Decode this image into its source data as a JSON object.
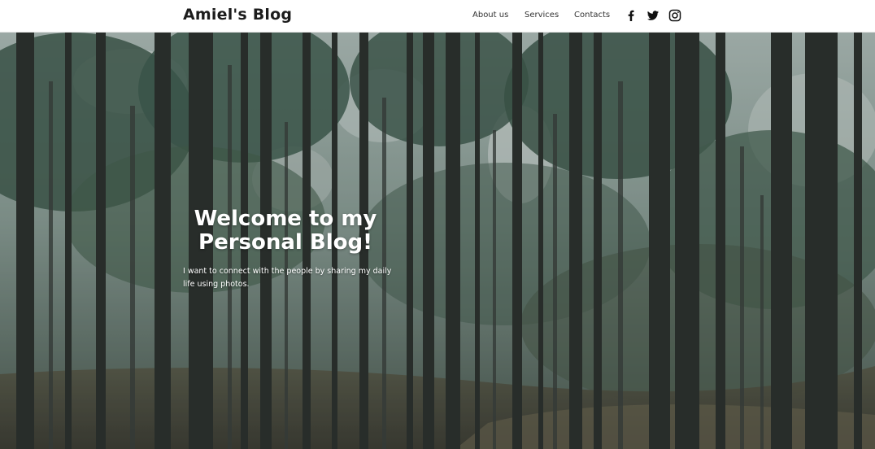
{
  "header": {
    "brand": "Amiel's Blog",
    "nav": [
      "About us",
      "Services",
      "Contacts"
    ],
    "social": [
      {
        "icon": "facebook-icon"
      },
      {
        "icon": "twitter-icon"
      },
      {
        "icon": "instagram-icon"
      }
    ]
  },
  "hero": {
    "title": "Welcome to my Personal Blog!",
    "text": "I want to connect with the people by sharing my daily life using photos.",
    "background": "forest-photo",
    "colors": {
      "sky": "#c8d4d0",
      "foliage": "#3d5a4c",
      "trunks": "#2a2e2c",
      "ground": "#4e4a3c"
    }
  }
}
